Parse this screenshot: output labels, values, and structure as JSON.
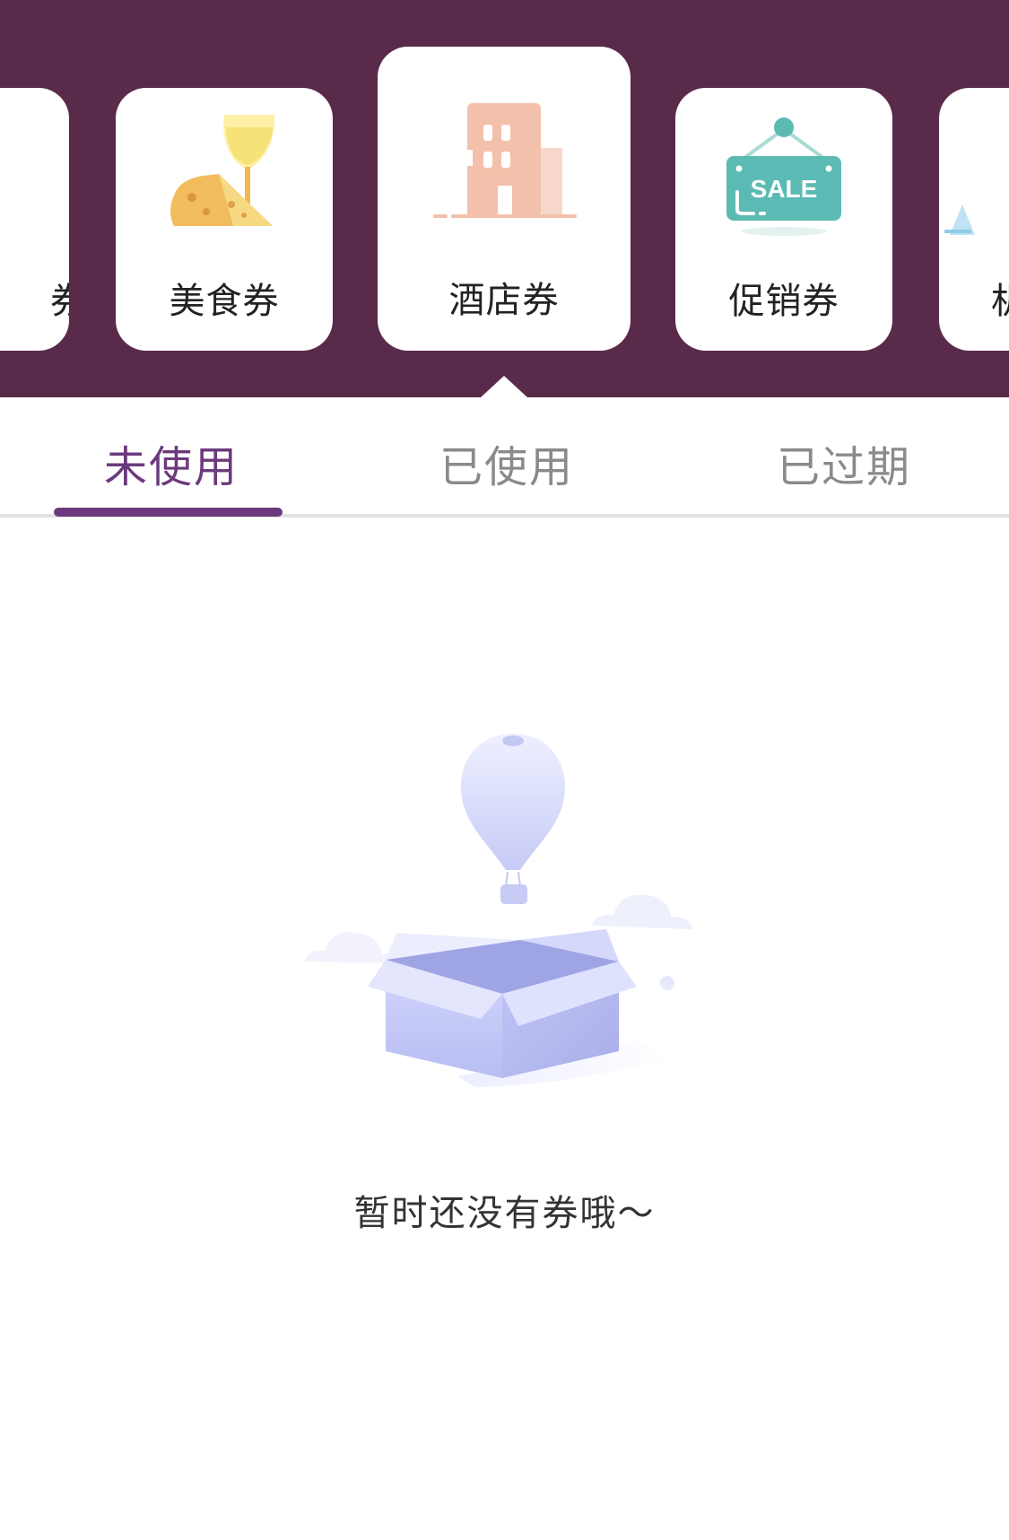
{
  "categories": [
    {
      "label": "券",
      "icon": "coupon-icon",
      "partial": "left"
    },
    {
      "label": "美食券",
      "icon": "food-cheese-wine-icon"
    },
    {
      "label": "酒店券",
      "icon": "hotel-building-icon",
      "selected": true
    },
    {
      "label": "促销券",
      "icon": "sale-sign-icon"
    },
    {
      "label": "机",
      "icon": "plane-icon",
      "partial": "right"
    }
  ],
  "tabs": [
    {
      "label": "未使用",
      "active": true
    },
    {
      "label": "已使用",
      "active": false
    },
    {
      "label": "已过期",
      "active": false
    }
  ],
  "empty_state": {
    "message": "暂时还没有券哦～",
    "icon": "empty-box-balloon-icon"
  },
  "colors": {
    "header_bg": "#5a2a4a",
    "accent": "#6b3a7c",
    "tab_inactive": "#8a8a8a",
    "sale_sign": "#5bbab3",
    "hotel": "#f3c1ab"
  }
}
